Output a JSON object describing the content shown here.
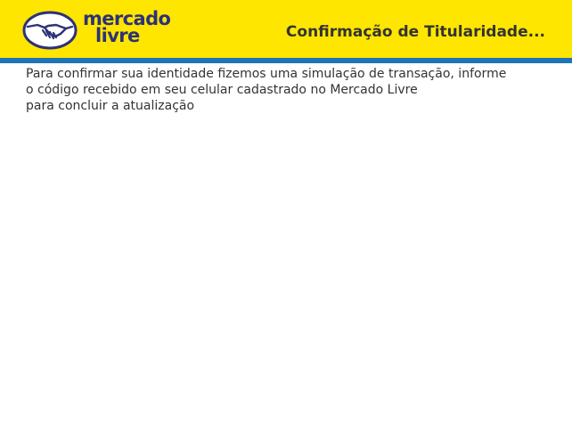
{
  "header": {
    "brand_line1": "mercado",
    "brand_line2": "livre",
    "title": "Confirmação de Titularidade..."
  },
  "message": {
    "lines": [
      "Para confirmar sua identidade fizemos uma simulação de transação, informe",
      "o código recebido em seu celular cadastrado no Mercado Livre",
      "para concluir a atualização"
    ]
  },
  "colors": {
    "header_background": "#ffe600",
    "header_stripe": "#1f73b7",
    "brand_text": "#2d3277",
    "body_text": "#333333"
  },
  "icons": {
    "logo_emblem": "handshake-icon"
  }
}
